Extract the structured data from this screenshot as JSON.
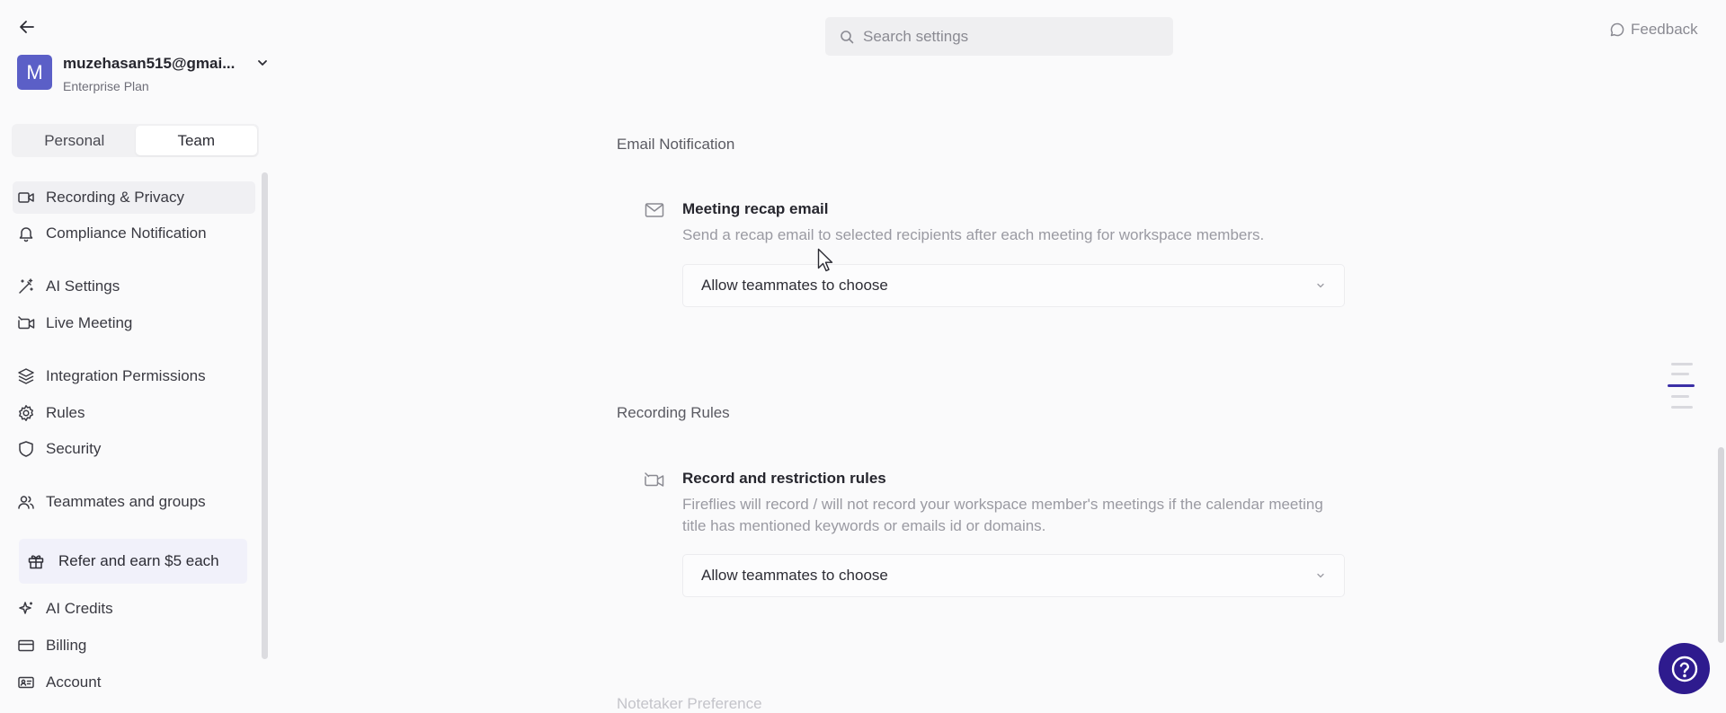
{
  "sidebar": {
    "account": {
      "avatar_initial": "M",
      "email": "muzehasan515@gmai...",
      "plan": "Enterprise Plan"
    },
    "tabs": [
      {
        "label": "Personal",
        "active": false
      },
      {
        "label": "Team",
        "active": true
      }
    ],
    "nav_items": [
      {
        "label": "Recording & Privacy",
        "icon": "video-icon",
        "selected": true
      },
      {
        "label": "Compliance Notification",
        "icon": "bell-icon"
      },
      {
        "label": "AI Settings",
        "icon": "magic-wand-icon"
      },
      {
        "label": "Live Meeting",
        "icon": "video-live-icon"
      },
      {
        "label": "Integration Permissions",
        "icon": "layers-icon"
      },
      {
        "label": "Rules",
        "icon": "gear-icon"
      },
      {
        "label": "Security",
        "icon": "shield-icon"
      },
      {
        "label": "Teammates and groups",
        "icon": "users-icon"
      },
      {
        "label": "AI Credits",
        "icon": "sparkle-icon"
      },
      {
        "label": "Billing",
        "icon": "credit-card-icon"
      },
      {
        "label": "Account",
        "icon": "id-card-icon"
      }
    ],
    "refer": {
      "label": "Refer and earn $5 each",
      "icon": "gift-icon"
    }
  },
  "header": {
    "search_placeholder": "Search settings",
    "feedback_label": "Feedback"
  },
  "main": {
    "sections": [
      {
        "title": "Email Notification",
        "settings": [
          {
            "icon": "mail-icon",
            "title": "Meeting recap email",
            "description": "Send a recap email to selected recipients after each meeting for workspace members.",
            "select_value": "Allow teammates to choose"
          }
        ]
      },
      {
        "title": "Recording Rules",
        "settings": [
          {
            "icon": "video-rules-icon",
            "title": "Record and restriction rules",
            "description": "Fireflies will record / will not record your workspace member's meetings if the calendar meeting title has mentioned keywords or emails id or domains.",
            "select_value": "Allow teammates to choose"
          }
        ]
      },
      {
        "title": "Notetaker Preference",
        "settings": []
      }
    ]
  },
  "colors": {
    "accent": "#2e1b8e",
    "avatar": "#5b5fc7",
    "toc_active": "#3b2fa6"
  }
}
